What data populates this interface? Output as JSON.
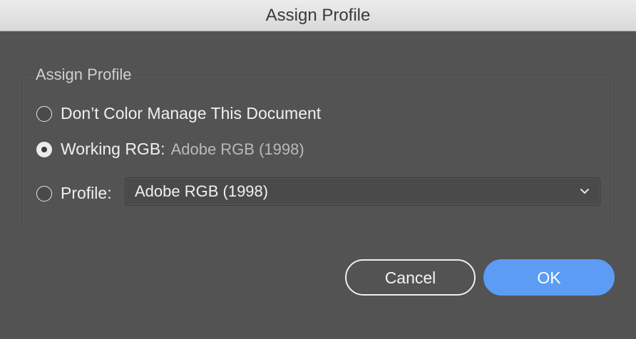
{
  "window": {
    "title": "Assign Profile"
  },
  "group": {
    "legend": "Assign Profile"
  },
  "options": {
    "dont_manage": {
      "label": "Don’t Color Manage This Document",
      "selected": false
    },
    "working_rgb": {
      "label": "Working RGB:",
      "value": "Adobe RGB (1998)",
      "selected": true
    },
    "profile": {
      "label": "Profile:",
      "selected": false
    }
  },
  "profile_select": {
    "selected_value": "Adobe RGB (1998)",
    "icon": "chevron-down-icon"
  },
  "buttons": {
    "cancel_label": "Cancel",
    "ok_label": "OK"
  },
  "colors": {
    "dialog_bg": "#535353",
    "accent": "#5c9cf4"
  }
}
